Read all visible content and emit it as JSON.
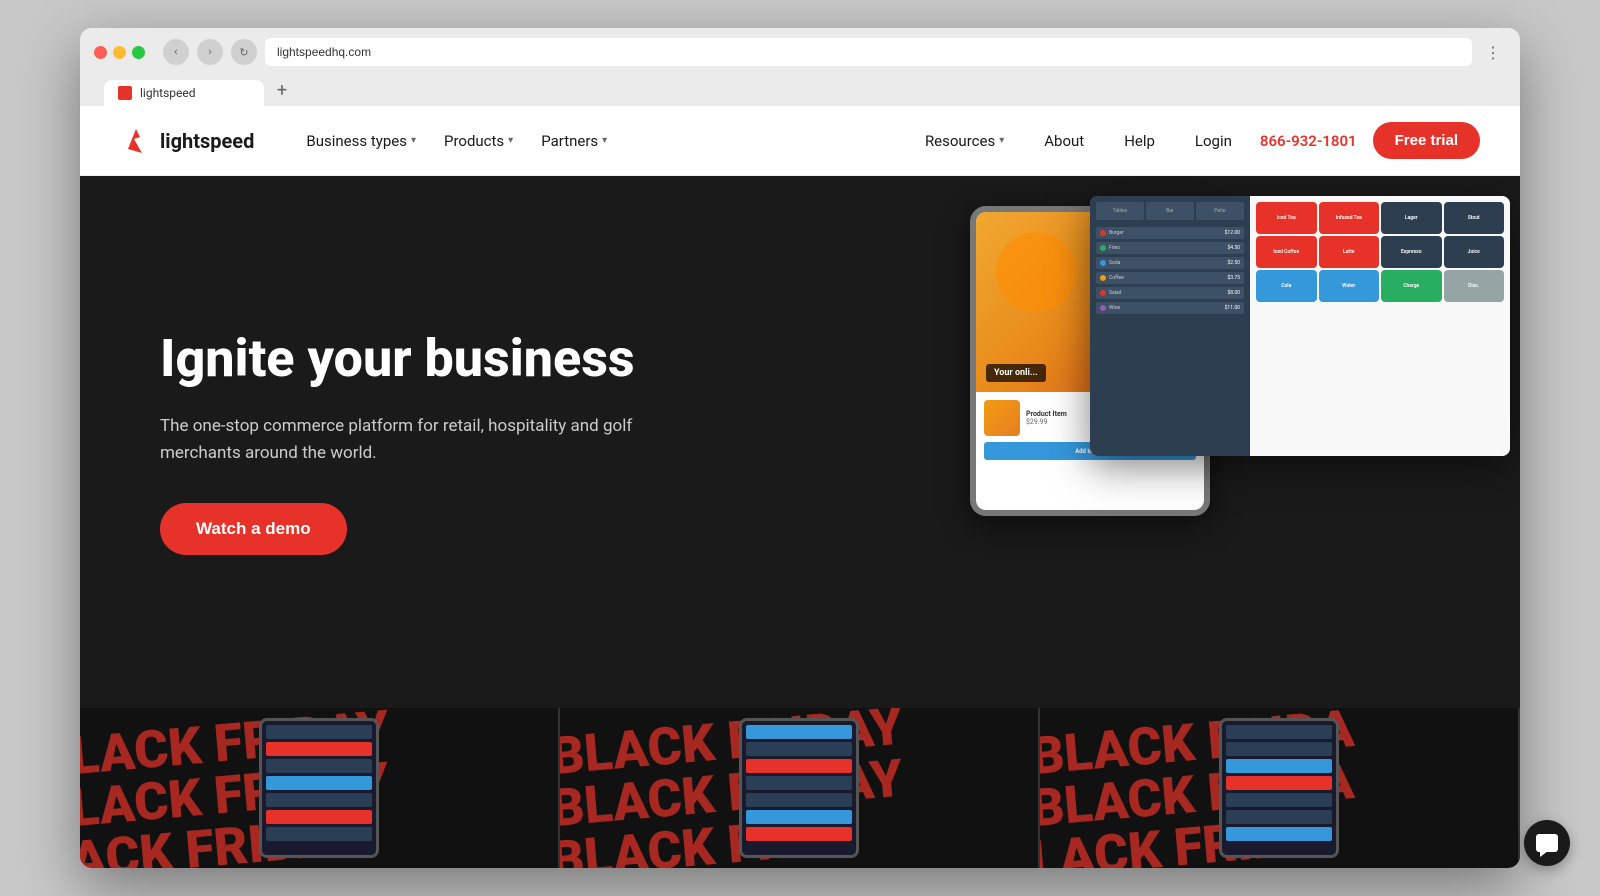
{
  "browser": {
    "tab_title": "lightspeed",
    "address": "lightspeedhq.com",
    "new_tab_label": "+"
  },
  "navbar": {
    "logo_text": "lightspeed",
    "nav_items": [
      {
        "label": "Business types",
        "has_dropdown": true
      },
      {
        "label": "Products",
        "has_dropdown": true
      },
      {
        "label": "Partners",
        "has_dropdown": true
      }
    ],
    "right_items": [
      {
        "label": "Resources",
        "has_dropdown": true
      },
      {
        "label": "About",
        "has_dropdown": false
      },
      {
        "label": "Help",
        "has_dropdown": false
      },
      {
        "label": "Login",
        "has_dropdown": false
      }
    ],
    "phone": "866-932-1801",
    "free_trial_label": "Free trial"
  },
  "hero": {
    "title": "Ignite your business",
    "subtitle": "The one-stop commerce platform for retail, hospitality and golf merchants around the world.",
    "cta_label": "Watch a demo"
  },
  "pos_ui": {
    "order_items": [
      "Burger",
      "Fries",
      "Soda",
      "Coffee"
    ],
    "your_online_text": "Your onli..."
  },
  "black_friday": {
    "text": "BLACK FRIDAY",
    "cards": [
      "LACK FRIDAY",
      "BLACK FRIDAY",
      "BLACK FRIDA"
    ]
  },
  "chat": {
    "label": "Chat"
  }
}
